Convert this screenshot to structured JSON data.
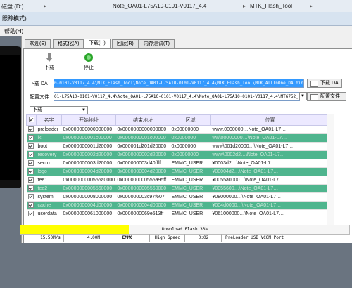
{
  "breadcrumb": {
    "drive": "磁盘 (D:)",
    "folder1": "Note_OA01-L75A10-0101-V0117_4.4",
    "folder2": "MTK_Flash_Tool"
  },
  "window": {
    "title": "跟踪模式)"
  },
  "menu": {
    "help": "帮助(H)"
  },
  "tabs": [
    {
      "label": "欢迎(E)"
    },
    {
      "label": "格式化(A)"
    },
    {
      "label": "下载(D)"
    },
    {
      "label": "回读(R)"
    },
    {
      "label": "内存测试(T)"
    }
  ],
  "toolbar": {
    "download": "下载",
    "stop": "停止"
  },
  "download_agent": {
    "label": "下载 DA",
    "value": "0-0101-V0117_4.4\\MTK_Flash_Tool\\Note_OA01-L75A10-0101-V0117_4.4\\MTK_Flash_Tool\\MTK_AllInOne_DA.bin",
    "button": "下载 DA"
  },
  "scatter": {
    "label": "配置文件",
    "value": "01-L75A10-0101-V0117_4.4\\Note_OA01-L75A10-0101-V0117_4.4\\Note_OA01-L75A10-0101-V0117_4.4\\MT6752_",
    "button": "配置文件"
  },
  "mode": {
    "selected": "下载"
  },
  "table": {
    "headers": [
      "",
      "名字",
      "开始地址",
      "结束地址",
      "区域",
      "位置"
    ],
    "rows": [
      {
        "checked": true,
        "name": "preloader",
        "start": "0x0000000000000000",
        "end": "0x0000000000000000",
        "region": "0x00000000",
        "location": "www.0000000…Note_OA01-L7…",
        "hl": false
      },
      {
        "checked": true,
        "name": "lk",
        "start": "0x0000000001c00000",
        "end": "0x0000000001c00000",
        "region": "0x0000000",
        "location": "ww\\00000000…\\Note_OA01-L7…",
        "hl": true
      },
      {
        "checked": true,
        "name": "boot",
        "start": "0x0000000001d20000",
        "end": "0x000001d201d20000",
        "region": "0x0000000",
        "location": "www\\001d20000…\\Note_OA01-L7…",
        "hl": false
      },
      {
        "checked": true,
        "name": "recovery",
        "start": "0x0000000002d20000",
        "end": "0x0000000002d20000",
        "region": "0x00000000",
        "location": "www\\0002d2…\\Note_OA01-L7…",
        "hl": true
      },
      {
        "checked": true,
        "name": "secro",
        "start": "0x0000000003d20000",
        "end": "0x000000003d40ffff",
        "region": "EMMC_USER",
        "location": "¥0003d2…\\Note_OA01-L7…",
        "hl": false
      },
      {
        "checked": true,
        "name": "logo",
        "start": "0x0000000004d20000",
        "end": "0x0000000004d20000",
        "region": "EMMC_USER",
        "location": "¥00004d2…\\Note_OA01-L7…",
        "hl": true
      },
      {
        "checked": true,
        "name": "tee1",
        "start": "0x000000000555a0000",
        "end": "0x000000000555a95ff",
        "region": "EMMC_USER",
        "location": "¥0055a0000…\\Note_OA01-L7…",
        "hl": false
      },
      {
        "checked": true,
        "name": "tee2",
        "start": "0x0000000005560000",
        "end": "0x0000000005560000",
        "region": "EMMC_USER",
        "location": "¥0055600…\\Note_OA01-L7…",
        "hl": true
      },
      {
        "checked": true,
        "name": "system",
        "start": "0x0000000008000000",
        "end": "0x000000003c97f607",
        "region": "EMMC_USER",
        "location": "¥08000000…\\Note_OA01-L7…",
        "hl": false
      },
      {
        "checked": true,
        "name": "cache",
        "start": "0x0000000004d00000",
        "end": "0x0000000004d00000",
        "region": "EMMC_USER",
        "location": "¥004d0000…\\Note_OA01-L7…",
        "hl": true
      },
      {
        "checked": true,
        "name": "userdata",
        "start": "0x0000000061000000",
        "end": "0x0000000069e513ff",
        "region": "EMMC_USER",
        "location": "¥061000000…\\Note_OA01-L7…",
        "hl": false
      }
    ]
  },
  "progress": {
    "text": "Download Flash 33%",
    "fraction": 0.33,
    "color": "#ffff00"
  },
  "statusbar": {
    "speed": "15.50M/s",
    "size": "4.00M",
    "storage": "EMMC",
    "usb_speed": "High Speed",
    "time": "0:02",
    "port": "PreLoader USB VCOM Port"
  },
  "colors": {
    "highlight_row": "#4fb58e",
    "selected_field": "#3399ff",
    "stop_icon": "#2aa52a"
  }
}
